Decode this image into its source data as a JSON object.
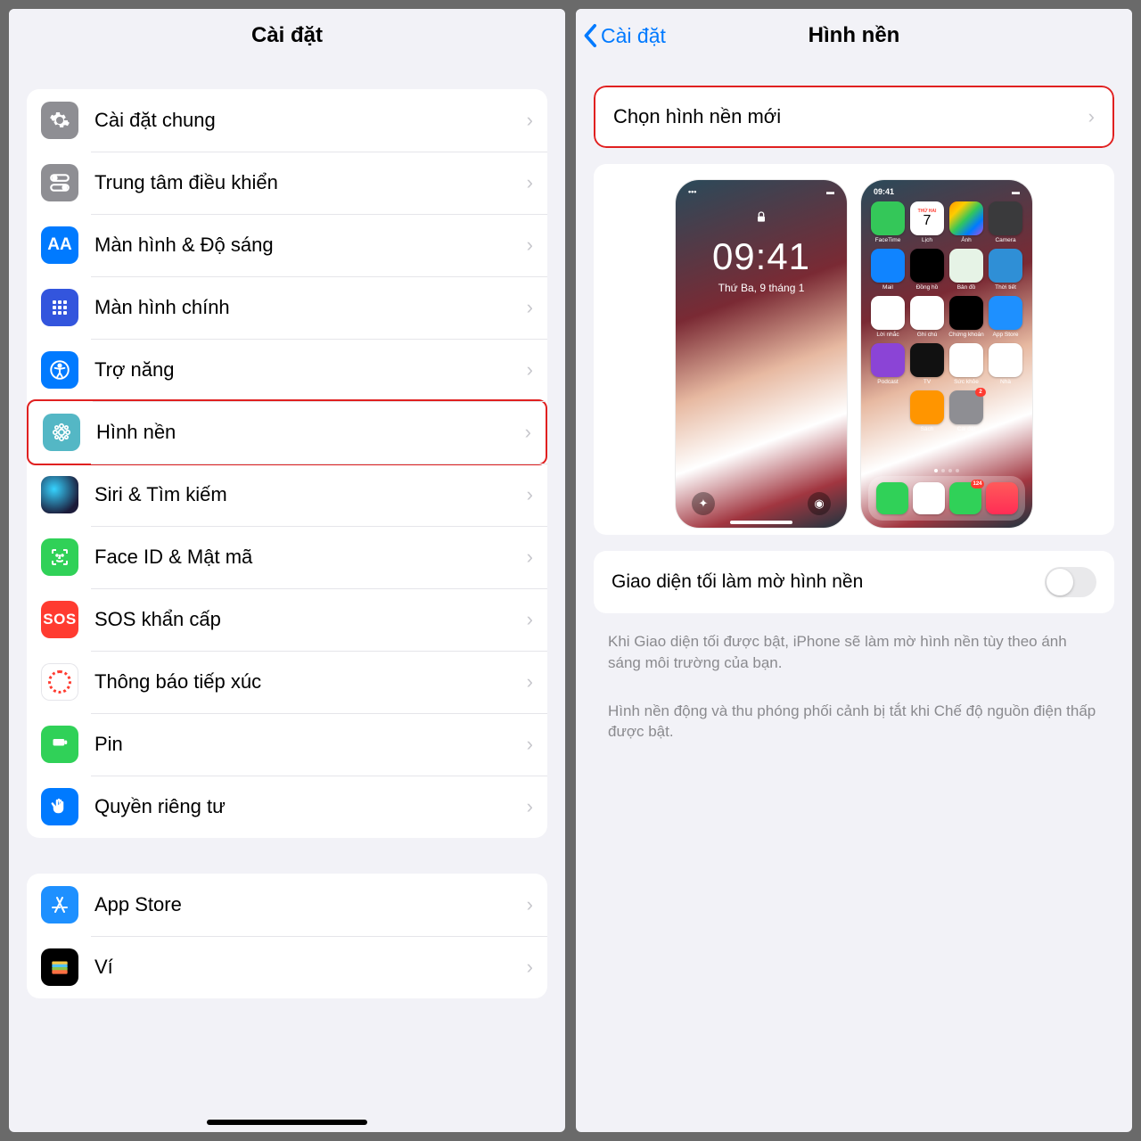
{
  "left": {
    "title": "Cài đặt",
    "items": [
      {
        "label": "Cài đặt chung",
        "icon": "general"
      },
      {
        "label": "Trung tâm điều khiển",
        "icon": "control"
      },
      {
        "label": "Màn hình & Độ sáng",
        "icon": "display"
      },
      {
        "label": "Màn hình chính",
        "icon": "home"
      },
      {
        "label": "Trợ năng",
        "icon": "access"
      },
      {
        "label": "Hình nền",
        "icon": "wallpaper",
        "highlight": true
      },
      {
        "label": "Siri & Tìm kiếm",
        "icon": "siri"
      },
      {
        "label": "Face ID & Mật mã",
        "icon": "faceid"
      },
      {
        "label": "SOS khẩn cấp",
        "icon": "sos"
      },
      {
        "label": "Thông báo tiếp xúc",
        "icon": "exposure"
      },
      {
        "label": "Pin",
        "icon": "battery"
      },
      {
        "label": "Quyền riêng tư",
        "icon": "privacy"
      }
    ],
    "items2": [
      {
        "label": "App Store",
        "icon": "appstore"
      },
      {
        "label": "Ví",
        "icon": "wallet"
      }
    ]
  },
  "right": {
    "back": "Cài đặt",
    "title": "Hình nền",
    "choose": "Chọn hình nền mới",
    "lock_time": "09:41",
    "lock_date": "Thứ Ba, 9 tháng 1",
    "home_status_time": "09:41",
    "home_day_header": "THỨ HAI",
    "home_day_number": "7",
    "apps": [
      "FaceTime",
      "Lịch",
      "Ảnh",
      "Camera",
      "Mail",
      "Đồng hồ",
      "Bản đồ",
      "Thời tiết",
      "Lời nhắc",
      "Ghi chú",
      "Chứng khoán",
      "App Store",
      "Podcast",
      "TV",
      "Sức khỏe",
      "Nhà",
      "",
      "Sách",
      "Cài đặt",
      ""
    ],
    "messages_badge": "124",
    "settings_badge": "2",
    "dim_label": "Giao diện tối làm mờ hình nền",
    "note1": "Khi Giao diện tối được bật, iPhone sẽ làm mờ hình nền tùy theo ánh sáng môi trường của bạn.",
    "note2": "Hình nền động và thu phóng phối cảnh bị tắt khi Chế độ nguồn điện thấp được bật."
  },
  "colors": {
    "accent": "#007aff",
    "highlight": "#e02020",
    "sos": "#ff3b30",
    "green": "#30d158"
  }
}
